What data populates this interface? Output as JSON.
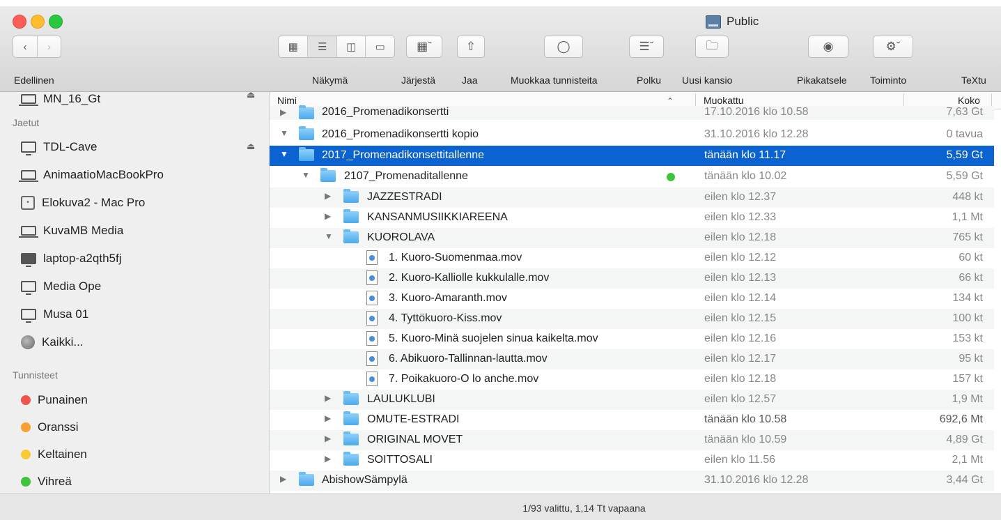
{
  "window": {
    "title": "Public"
  },
  "toolbar": {
    "back_label": "Edellinen",
    "view_label": "Näkymä",
    "arrange_label": "Järjestä",
    "share_label": "Jaa",
    "tags_label": "Muokkaa tunnisteita",
    "path_label": "Polku",
    "new_folder_label": "Uusi kansio",
    "quicklook_label": "Pikakatsele",
    "action_label": "Toiminto",
    "extra_label": "TeXtu"
  },
  "sidebar": {
    "top_item": "MN_16_Gt",
    "shared_header": "Jaetut",
    "shared": [
      {
        "label": "TDL-Cave",
        "icon": "monitor-icon"
      },
      {
        "label": "AnimaatioMacBookPro",
        "icon": "laptop-icon"
      },
      {
        "label": "Elokuva2 - Mac Pro",
        "icon": "server-icon"
      },
      {
        "label": "KuvaMB Media",
        "icon": "laptop-icon"
      },
      {
        "label": "laptop-a2qth5fj",
        "icon": "monitor-icon"
      },
      {
        "label": "Media Ope",
        "icon": "monitor-icon"
      },
      {
        "label": "Musa 01",
        "icon": "monitor-icon"
      },
      {
        "label": "Kaikki...",
        "icon": "globe-icon"
      }
    ],
    "tags_header": "Tunnisteet",
    "tags": [
      {
        "label": "Punainen",
        "color": "#f0544c"
      },
      {
        "label": "Oranssi",
        "color": "#f6a033"
      },
      {
        "label": "Keltainen",
        "color": "#f8ca34"
      },
      {
        "label": "Vihreä",
        "color": "#3fc43c"
      }
    ]
  },
  "columns": {
    "name": "Nimi",
    "modified": "Muokattu",
    "size": "Koko"
  },
  "rows": [
    {
      "name": "2016_Promenadikonsertti",
      "date": "17.10.2016 klo 10.58",
      "size": "7,63 Gt"
    },
    {
      "name": "2016_Promenadikonsertti kopio",
      "date": "31.10.2016 klo 12.28",
      "size": "0 tavua"
    },
    {
      "name": "2017_Promenadikonsettitallenne",
      "date": "tänään klo 11.17",
      "size": "5,59 Gt"
    },
    {
      "name": "2107_Promenaditallenne",
      "date": "tänään klo 10.02",
      "size": "5,59 Gt"
    },
    {
      "name": "JAZZESTRADI",
      "date": "eilen klo 12.37",
      "size": "448 kt"
    },
    {
      "name": "KANSANMUSIIKKIAREENA",
      "date": "eilen klo 12.33",
      "size": "1,1 Mt"
    },
    {
      "name": "KUOROLAVA",
      "date": "eilen klo 12.18",
      "size": "765 kt"
    },
    {
      "name": "1. Kuoro-Suomenmaa.mov",
      "date": "eilen klo 12.12",
      "size": "60 kt"
    },
    {
      "name": "2. Kuoro-Kalliolle kukkulalle.mov",
      "date": "eilen klo 12.13",
      "size": "66 kt"
    },
    {
      "name": "3. Kuoro-Amaranth.mov",
      "date": "eilen klo 12.14",
      "size": "134 kt"
    },
    {
      "name": "4. Tyttökuoro-Kiss.mov",
      "date": "eilen klo 12.15",
      "size": "100 kt"
    },
    {
      "name": "5. Kuoro-Minä suojelen sinua kaikelta.mov",
      "date": "eilen klo 12.16",
      "size": "153 kt"
    },
    {
      "name": "6. Abikuoro-Tallinnan-lautta.mov",
      "date": "eilen klo 12.17",
      "size": "95 kt"
    },
    {
      "name": "7. Poikakuoro-O lo anche.mov",
      "date": "eilen klo 12.18",
      "size": "157 kt"
    },
    {
      "name": "LAULUKLUBI",
      "date": "eilen klo 12.57",
      "size": "1,9 Mt"
    },
    {
      "name": "OMUTE-ESTRADI",
      "date": "tänään klo 10.58",
      "size": "692,6 Mt"
    },
    {
      "name": "ORIGINAL MOVET",
      "date": "tänään klo 10.59",
      "size": "4,89 Gt"
    },
    {
      "name": "SOITTOSALI",
      "date": "eilen klo 11.56",
      "size": "2,1 Mt"
    },
    {
      "name": "AbishowSämpylä",
      "date": "31.10.2016 klo 12.28",
      "size": "3,44 Gt"
    }
  ],
  "status": {
    "text": "1/93 valittu, 1,14 Tt vapaana"
  }
}
